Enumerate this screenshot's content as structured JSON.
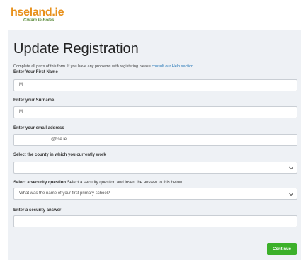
{
  "brand": {
    "name": "hseland.ie",
    "tagline": "Cúram le Eolas"
  },
  "form": {
    "title": "Update Registration",
    "intro_text": "Complete all parts of this form. If you have any problems with registering please",
    "intro_link": "consult our Help section.",
    "first_name": {
      "label": "Enter Your First Name",
      "value": "M"
    },
    "surname": {
      "label": "Enter your Surname",
      "value": "M"
    },
    "email": {
      "label": "Enter your email address",
      "value": "@hse.ie"
    },
    "county": {
      "label": "Select the county in which you currently work",
      "value": ""
    },
    "security_question": {
      "label": "Select a security question",
      "note": "Select a security question and insert the answer to this below.",
      "value": "What was the name of your first primary school?"
    },
    "security_answer": {
      "label": "Enter a security answer",
      "value": ""
    },
    "continue_label": "Continue"
  },
  "colors": {
    "brand_orange": "#e8901a",
    "tagline_green": "#5a8a3a",
    "button_green": "#3cb02a",
    "link_blue": "#2a7ab8",
    "panel_bg": "#eef1f5"
  },
  "icons": {
    "dropdown": "chevron-down-icon"
  }
}
